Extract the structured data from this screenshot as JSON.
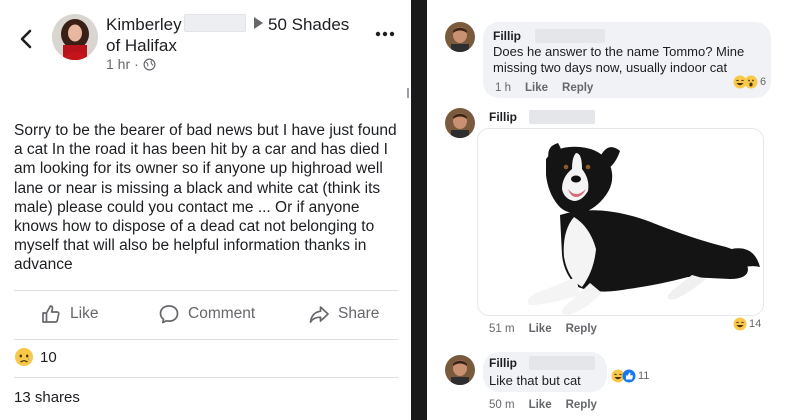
{
  "post": {
    "author": "Kimberley",
    "author_line2": "of Halifax",
    "group": "50 Shades",
    "time": "1 hr",
    "body": "Sorry to be the bearer of bad news but I have just found a cat In the road it has been hit by a car and has died I am looking for its owner so if anyone up highroad well lane or near is missing a black and white cat (think its male) please could you contact me ... Or if anyone knows how to dispose of a dead cat not belonging to myself that will also be helpful information thanks in advance",
    "actions": {
      "like": "Like",
      "comment": "Comment",
      "share": "Share"
    },
    "reaction_count": "10",
    "shares": "13 shares"
  },
  "comments": [
    {
      "name": "Fillip",
      "text_line1": "Does he answer to the name Tommo? Mine",
      "text_line2": "missing two days now, usually indoor cat",
      "time": "1 h",
      "like": "Like",
      "reply": "Reply",
      "reaction_count": "6"
    },
    {
      "name": "Fillip",
      "image": "dog-photo",
      "time": "51 m",
      "like": "Like",
      "reply": "Reply",
      "reaction_count": "14"
    },
    {
      "name": "Fillip",
      "text_line1": "Like that but cat",
      "time": "50 m",
      "like": "Like",
      "reply": "Reply",
      "reaction_count": "11"
    }
  ],
  "colors": {
    "text": "#1c1e21",
    "muted": "#65676b",
    "bubble": "#f0f2f5",
    "separator": "#1a1a1a",
    "like_blue": "#1877f2"
  },
  "icons": [
    "back-chevron-icon",
    "globe-icon",
    "more-icon",
    "like-icon",
    "comment-icon",
    "share-icon",
    "sad-emoji-icon",
    "laugh-emoji-icon",
    "wow-emoji-icon",
    "like-reaction-icon"
  ]
}
